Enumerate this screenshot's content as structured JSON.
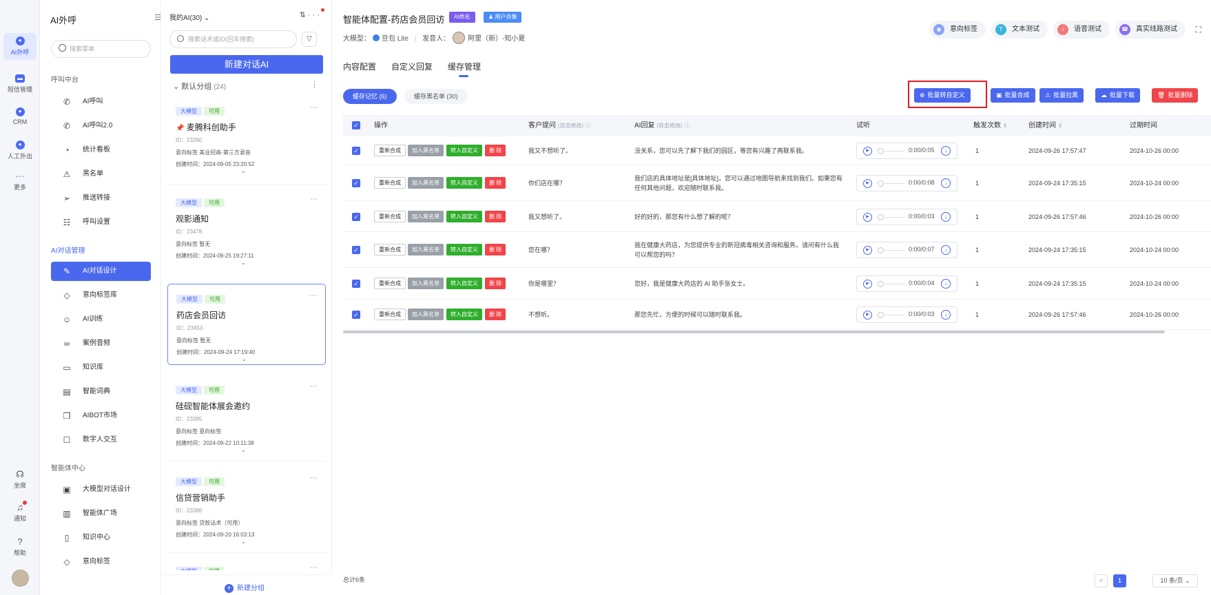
{
  "rail": {
    "items": [
      {
        "label": "AI外呼",
        "icon": "robot-icon"
      },
      {
        "label": "短信管理",
        "icon": "sms-icon"
      },
      {
        "label": "CRM",
        "icon": "crm-icon"
      },
      {
        "label": "人工外出",
        "icon": "agent-icon"
      },
      {
        "label": "更多",
        "icon": "more-dots-icon"
      }
    ],
    "bottom": [
      {
        "label": "坐席",
        "icon": "headset-icon"
      },
      {
        "label": "通知",
        "icon": "bell-icon"
      },
      {
        "label": "帮助",
        "icon": "help-icon"
      }
    ]
  },
  "menu": {
    "title": "AI外呼",
    "search_placeholder": "搜索菜单",
    "groups": [
      {
        "title": "呼叫中台",
        "items": [
          "AI呼叫",
          "AI呼叫2.0",
          "统计看板",
          "黑名单",
          "推送转接",
          "呼叫设置"
        ]
      },
      {
        "title": "AI对话管理",
        "items": [
          "AI对话设计",
          "意向标签库",
          "AI训练",
          "案例音频",
          "知识库",
          "智能词典",
          "AIBOT市场",
          "数字人交互"
        ]
      },
      {
        "title": "智能体中心",
        "items": [
          "大模型对话设计",
          "智能体广场",
          "知识中心",
          "意向标签"
        ]
      }
    ],
    "active_item": "AI对话设计"
  },
  "ai_list": {
    "header": "我的AI(30)",
    "search_placeholder": "搜索话术或ID(回车搜索)",
    "new_button": "新建对话AI",
    "group_name": "默认分组",
    "group_count": "(24)",
    "new_group": "新建分组",
    "tag_model": "大模型",
    "tag_ok": "可用",
    "cards": [
      {
        "name": "麦腾科创助手",
        "pinned": true,
        "id": "ID：23260",
        "intent": "意向标签 美业招商-第三方录音",
        "created": "创建时间：2024-09-05 23:20:52"
      },
      {
        "name": "观影通知",
        "pinned": false,
        "id": "ID：23478",
        "intent": "意向标签 暂无",
        "created": "创建时间：2024-09-25 19:27:11"
      },
      {
        "name": "药店会员回访",
        "pinned": false,
        "id": "ID：23453",
        "intent": "意向标签 暂无",
        "created": "创建时间：2024-09-24 17:19:40"
      },
      {
        "name": "硅砚智能体展会邀约",
        "pinned": false,
        "id": "ID：23395",
        "intent": "意向标签 意向标签",
        "created": "创建时间：2024-09-22 10:11:38"
      },
      {
        "name": "信贷营销助手",
        "pinned": false,
        "id": "ID：23386",
        "intent": "意向标签 贷款话术（可用）",
        "created": "创建时间：2024-09-20 16:03:13"
      }
    ]
  },
  "main": {
    "title": "智能体配置-药店会员回访",
    "badge_ai": "AI命名",
    "badge_user": "用户肖像",
    "model_label": "大模型：",
    "model_name": "豆包 Lite",
    "speaker_label": "发音人：",
    "speaker_name": "阿里（新）-知小夏",
    "top_buttons": [
      "意向标签",
      "文本测试",
      "语音测试",
      "真实线路测试"
    ],
    "tabs": [
      "内容配置",
      "自定义回复",
      "缓存管理"
    ],
    "active_tab": "缓存管理",
    "sub_tabs": {
      "memory": "缓存记忆 (6)",
      "blacklist": "缓存黑名单 (30)"
    },
    "actions": [
      "批量转自定义",
      "批量合成",
      "批量拉黑",
      "批量下载",
      "批量删除"
    ],
    "table": {
      "columns": {
        "op": "操作",
        "question": "客户提问",
        "question_hint": "(双击修改)",
        "answer": "AI回复",
        "answer_hint": "(双击修改)",
        "listen": "试听",
        "count": "触发次数",
        "created": "创建时间",
        "expires": "过期时间"
      },
      "op_labels": {
        "regen": "重新合成",
        "black": "加入黑名单",
        "custom": "转入自定义",
        "del": "删 除"
      },
      "rows": [
        {
          "question": "我又不想听了。",
          "answer": "没关系，您可以先了解下我们的园区，等您有兴趣了再联系我。",
          "duration": "0:00/0:05",
          "count": "1",
          "created": "2024-09-26 17:57:47",
          "expires": "2024-10-26 00:00"
        },
        {
          "question": "你们店在哪？",
          "answer": "我们店的具体地址是[具体地址]，您可以通过地图导航来找到我们。如果您有任何其他问题，欢迎随时联系我。",
          "duration": "0:00/0:08",
          "count": "1",
          "created": "2024-09-24 17:35:15",
          "expires": "2024-10-24 00:00"
        },
        {
          "question": "我又想听了。",
          "answer": "好的好的，那您有什么想了解的呢？",
          "duration": "0:00/0:03",
          "count": "1",
          "created": "2024-09-26 17:57:46",
          "expires": "2024-10-26 00:00"
        },
        {
          "question": "您在哪？",
          "answer": "我在健康大药店，为您提供专业的新冠病毒相关咨询和服务。请问有什么我可以帮您的吗？",
          "duration": "0:00/0:07",
          "count": "1",
          "created": "2024-09-24 17:35:15",
          "expires": "2024-10-24 00:00"
        },
        {
          "question": "你是哪里？",
          "answer": "您好，我是健康大药店的 AI 助手张女士。",
          "duration": "0:00/0:04",
          "count": "1",
          "created": "2024-09-24 17:35:15",
          "expires": "2024-10-24 00:00"
        },
        {
          "question": "不想听。",
          "answer": "那您先忙，方便的时候可以随时联系我。",
          "duration": "0:00/0:03",
          "count": "1",
          "created": "2024-09-26 17:57:46",
          "expires": "2024-10-26 00:00"
        }
      ]
    },
    "total": "总计6条",
    "page": "1",
    "page_size": "10 条/页"
  }
}
